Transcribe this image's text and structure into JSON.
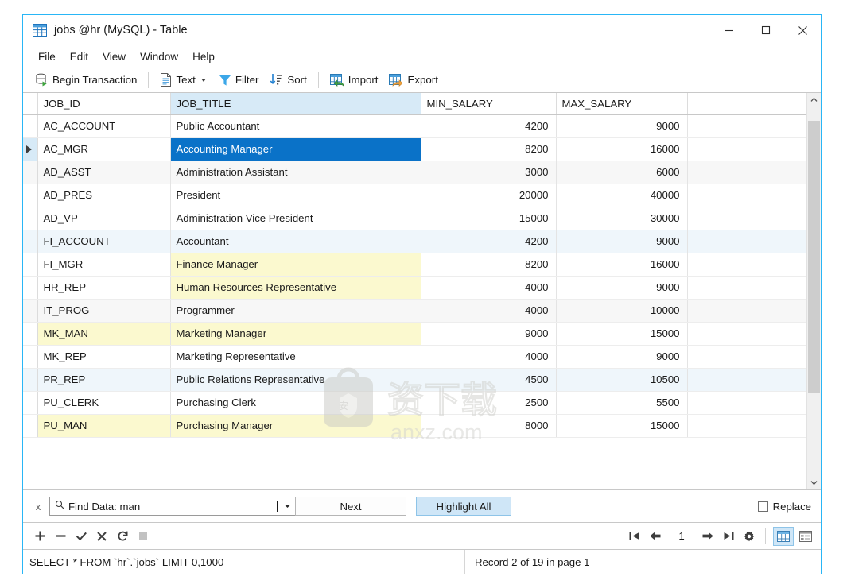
{
  "window": {
    "title": "jobs @hr (MySQL) - Table",
    "app_icon": "table-grid-icon",
    "minimize_label": "Minimize",
    "maximize_label": "Maximize",
    "close_label": "Close",
    "accent_color": "#29b6f6"
  },
  "menubar": {
    "items": [
      {
        "label": "File"
      },
      {
        "label": "Edit"
      },
      {
        "label": "View"
      },
      {
        "label": "Window"
      },
      {
        "label": "Help"
      }
    ]
  },
  "toolbar": {
    "begin_transaction": "Begin Transaction",
    "text": "Text",
    "filter": "Filter",
    "sort": "Sort",
    "import": "Import",
    "export": "Export"
  },
  "grid": {
    "columns": [
      {
        "key": "job_id",
        "label": "JOB_ID",
        "align": "left",
        "highlighted": false
      },
      {
        "key": "job_title",
        "label": "JOB_TITLE",
        "align": "left",
        "highlighted": true
      },
      {
        "key": "min_salary",
        "label": "MIN_SALARY",
        "align": "right",
        "highlighted": false
      },
      {
        "key": "max_salary",
        "label": "MAX_SALARY",
        "align": "right",
        "highlighted": false
      }
    ],
    "rows": [
      {
        "job_id": "AC_ACCOUNT",
        "job_title": "Public Accountant",
        "min_salary": "4200",
        "max_salary": "9000",
        "band": "white",
        "current": false,
        "selected_cell": null,
        "match_cells": []
      },
      {
        "job_id": "AC_MGR",
        "job_title": "Accounting Manager",
        "min_salary": "8200",
        "max_salary": "16000",
        "band": "white",
        "current": true,
        "selected_cell": "job_title",
        "match_cells": []
      },
      {
        "job_id": "AD_ASST",
        "job_title": "Administration Assistant",
        "min_salary": "3000",
        "max_salary": "6000",
        "band": "gray",
        "current": false,
        "selected_cell": null,
        "match_cells": []
      },
      {
        "job_id": "AD_PRES",
        "job_title": "President",
        "min_salary": "20000",
        "max_salary": "40000",
        "band": "white",
        "current": false,
        "selected_cell": null,
        "match_cells": []
      },
      {
        "job_id": "AD_VP",
        "job_title": "Administration Vice President",
        "min_salary": "15000",
        "max_salary": "30000",
        "band": "white",
        "current": false,
        "selected_cell": null,
        "match_cells": []
      },
      {
        "job_id": "FI_ACCOUNT",
        "job_title": "Accountant",
        "min_salary": "4200",
        "max_salary": "9000",
        "band": "blue",
        "current": false,
        "selected_cell": null,
        "match_cells": []
      },
      {
        "job_id": "FI_MGR",
        "job_title": "Finance Manager",
        "min_salary": "8200",
        "max_salary": "16000",
        "band": "white",
        "current": false,
        "selected_cell": null,
        "match_cells": [
          "job_title"
        ]
      },
      {
        "job_id": "HR_REP",
        "job_title": "Human Resources Representative",
        "min_salary": "4000",
        "max_salary": "9000",
        "band": "white",
        "current": false,
        "selected_cell": null,
        "match_cells": [
          "job_title"
        ]
      },
      {
        "job_id": "IT_PROG",
        "job_title": "Programmer",
        "min_salary": "4000",
        "max_salary": "10000",
        "band": "gray",
        "current": false,
        "selected_cell": null,
        "match_cells": []
      },
      {
        "job_id": "MK_MAN",
        "job_title": "Marketing Manager",
        "min_salary": "9000",
        "max_salary": "15000",
        "band": "white",
        "current": false,
        "selected_cell": null,
        "match_cells": [
          "job_id",
          "job_title"
        ]
      },
      {
        "job_id": "MK_REP",
        "job_title": "Marketing Representative",
        "min_salary": "4000",
        "max_salary": "9000",
        "band": "white",
        "current": false,
        "selected_cell": null,
        "match_cells": []
      },
      {
        "job_id": "PR_REP",
        "job_title": "Public Relations Representative",
        "min_salary": "4500",
        "max_salary": "10500",
        "band": "blue",
        "current": false,
        "selected_cell": null,
        "match_cells": []
      },
      {
        "job_id": "PU_CLERK",
        "job_title": "Purchasing Clerk",
        "min_salary": "2500",
        "max_salary": "5500",
        "band": "white",
        "current": false,
        "selected_cell": null,
        "match_cells": []
      },
      {
        "job_id": "PU_MAN",
        "job_title": "Purchasing Manager",
        "min_salary": "8000",
        "max_salary": "15000",
        "band": "white",
        "current": false,
        "selected_cell": null,
        "match_cells": [
          "job_id",
          "job_title"
        ]
      }
    ],
    "highlight_color": "#fbf9cf",
    "selection_color": "#0a72c8"
  },
  "findbar": {
    "close_label": "x",
    "value": "Find Data: man",
    "placeholder": "Find Data:",
    "next_label": "Next",
    "highlight_all_label": "Highlight All",
    "highlight_all_active": true,
    "replace_label": "Replace",
    "replace_checked": false
  },
  "editbar": {
    "add_label": "+",
    "delete_label": "−",
    "apply_label": "✓",
    "cancel_label": "✗",
    "refresh_label": "↻",
    "stop_label": "■"
  },
  "nav": {
    "first_label": "First record",
    "prev_label": "Previous record",
    "page": "1",
    "next_label": "Next record",
    "last_label": "Last record",
    "settings_label": "Options",
    "grid_view_label": "Grid view",
    "form_view_label": "Form view",
    "grid_view_active": true
  },
  "status": {
    "sql": "SELECT * FROM `hr`.`jobs` LIMIT 0,1000",
    "record": "Record 2 of 19 in page 1"
  },
  "watermark": {
    "text": "anxz.com"
  }
}
